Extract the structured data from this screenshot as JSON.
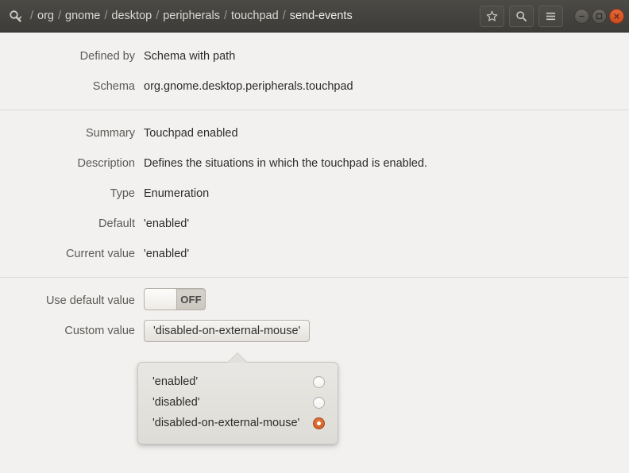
{
  "titlebar": {
    "app_icon": "wrench-search-icon",
    "breadcrumb": {
      "separator": "/",
      "crumbs": [
        "org",
        "gnome",
        "desktop",
        "peripherals",
        "touchpad"
      ],
      "current": "send-events"
    },
    "buttons": [
      {
        "name": "bookmark-star-button",
        "icon": "star-icon"
      },
      {
        "name": "search-button",
        "icon": "search-icon"
      },
      {
        "name": "menu-button",
        "icon": "hamburger-menu-icon"
      }
    ],
    "window_controls": [
      {
        "name": "minimize-button",
        "glyph": "−"
      },
      {
        "name": "maximize-button",
        "glyph": "□"
      },
      {
        "name": "close-button",
        "glyph": "×"
      }
    ],
    "colors": {
      "background": "#454340",
      "accent_underline": "#e8854a",
      "close_button": "#d9552c"
    }
  },
  "sections": [
    {
      "name": "schema-section",
      "rows": [
        {
          "label": "Defined by",
          "value": "Schema with path"
        },
        {
          "label": "Schema",
          "value": "org.gnome.desktop.peripherals.touchpad"
        }
      ]
    },
    {
      "name": "key-info-section",
      "rows": [
        {
          "label": "Summary",
          "value": "Touchpad enabled"
        },
        {
          "label": "Description",
          "value": "Defines the situations in which the touchpad is enabled."
        },
        {
          "label": "Type",
          "value": "Enumeration"
        },
        {
          "label": "Default",
          "value": "'enabled'"
        },
        {
          "label": "Current value",
          "value": "'enabled'"
        }
      ]
    }
  ],
  "editor": {
    "use_default": {
      "label": "Use default value",
      "state": "OFF"
    },
    "custom_value": {
      "label": "Custom value",
      "value": "'disabled-on-external-mouse'"
    }
  },
  "popover": {
    "name": "enumeration-choice-popover",
    "options": [
      {
        "label": "'enabled'",
        "selected": false
      },
      {
        "label": "'disabled'",
        "selected": false
      },
      {
        "label": "'disabled-on-external-mouse'",
        "selected": true
      }
    ],
    "selected_color": "#d45f25"
  }
}
